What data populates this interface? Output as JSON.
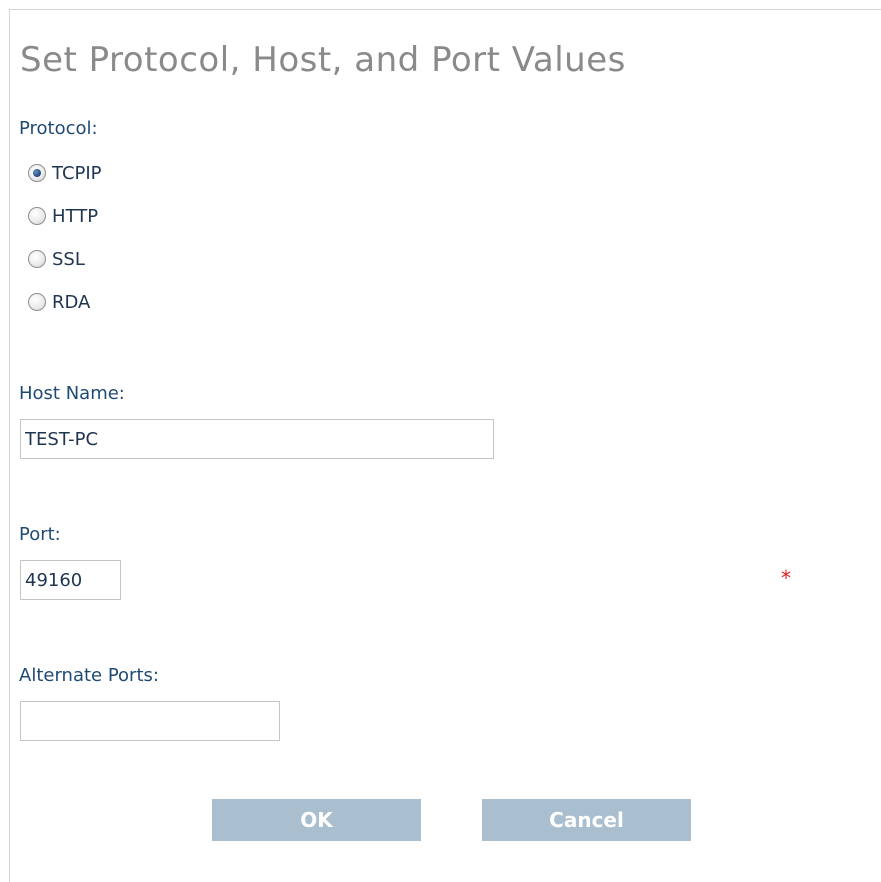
{
  "dialog": {
    "title": "Set Protocol, Host, and Port Values"
  },
  "protocol": {
    "label": "Protocol:",
    "selected": "TCPIP",
    "options": [
      {
        "label": "TCPIP",
        "checked": true
      },
      {
        "label": "HTTP",
        "checked": false
      },
      {
        "label": "SSL",
        "checked": false
      },
      {
        "label": "RDA",
        "checked": false
      }
    ]
  },
  "host": {
    "label": "Host Name:",
    "value": "TEST-PC"
  },
  "port": {
    "label": "Port:",
    "value": "49160",
    "required_marker": "*"
  },
  "alternate_ports": {
    "label": "Alternate Ports:",
    "value": ""
  },
  "buttons": {
    "ok_label": "OK",
    "cancel_label": "Cancel"
  },
  "colors": {
    "title": "#8a8a8a",
    "label": "#1f4a73",
    "required": "#e02020",
    "button_bg": "#a9bfd0",
    "button_text": "#ffffff"
  }
}
